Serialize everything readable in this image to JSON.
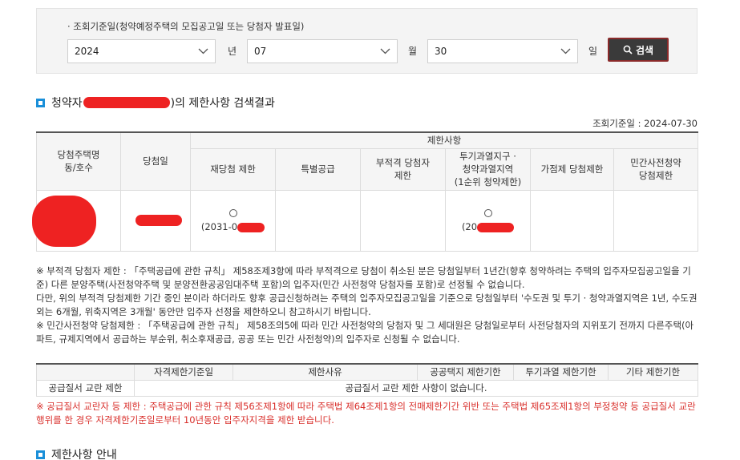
{
  "search": {
    "caption": "· 조회기준일(청약예정주택의 모집공고일 또는 당첨자 발표일)",
    "year_value": "2024",
    "year_unit": "년",
    "month_value": "07",
    "month_unit": "월",
    "day_value": "30",
    "day_unit": "일",
    "button_label": "검색",
    "button_icon": "search-icon"
  },
  "results": {
    "title_prefix": "청약자",
    "title_suffix": ")의 제한사항 검색결과",
    "ref_date": "조회기준일 : 2024-07-30",
    "headers": {
      "house": "당첨주택명\n동/호수",
      "win_date": "당첨일",
      "restrictions": "제한사항",
      "rewin": "재당첨 제한",
      "special": "특별공급",
      "illegal": "부적격 당첨자\n제한",
      "speculative": "투기과열지구 ·\n청약과열지역\n(1순위 청약제한)",
      "points": "가점제 당첨제한",
      "private_pre": "민간사전청약\n당첨제한"
    },
    "row": {
      "house": "",
      "win_date": "",
      "rewin_mark": "○",
      "rewin_date": "(2031-0",
      "special": "",
      "illegal": "",
      "speculative_mark": "○",
      "speculative_date": "(20",
      "points": "",
      "private_pre": ""
    }
  },
  "notes": [
    "※ 부적격 당첨자 제한 : 「주택공급에 관한 규칙」 제58조제3항에 따라 부적격으로 당첨이 취소된 분은 당첨일부터 1년간(향후 청약하려는 주택의 입주자모집공고일을 기준) 다른 분양주택(사전청약주택 및 분양전환공공임대주택 포함)의 입주자(민간 사전청약 당첨자를 포함)로 선정될 수 없습니다.",
    "다만, 위의 부적격 당첨제한 기간 중인 분이라 하더라도 향후 공급신청하려는 주택의 입주자모집공고일을 기준으로 당첨일부터 '수도권 및 투기 · 청약과열지역은 1년, 수도권 외는 6개월, 위축지역은 3개월' 동안만 입주자 선정을 제한하오니 참고하시기 바랍니다.",
    "※ 민간사전청약 당첨제한 : 「주택공급에 관한 규칙」 제58조의5에 따라 민간 사전청약의 당첨자 및 그 세대원은 당첨일로부터 사전당첨자의 지위포기 전까지 다른주택(아파트, 규제지역에서 공급하는 부순위, 취소후재공급, 공공 또는 민간 사전청약)의 입주자로 신청될 수 없습니다."
  ],
  "limits": {
    "headers": [
      "",
      "자격제한기준일",
      "제한사유",
      "공공택지 제한기한",
      "투기과열 제한기한",
      "기타 제한기한"
    ],
    "row_label": "공급질서 교란 제한",
    "row_message": "공급질서 교란 제한 사항이 없습니다.",
    "note": "※ 공급질서 교란자 등 제한 : 주택공급에 관한 규칙 제56조제1항에 따라 주택법 제64조제1항의 전매제한기간 위반 또는 주택법 제65조제1항의 부정청약 등 공급질서 교란행위를 한 경우 자격제한기준일로부터 10년동안 입주자지격을 제한 받습니다."
  },
  "guide": {
    "title": "제한사항 안내"
  },
  "colors": {
    "accent": "#1a8fd9",
    "redaction": "#ee2222",
    "warning_text": "#d9302c",
    "button_bg": "#3a3a3a"
  }
}
